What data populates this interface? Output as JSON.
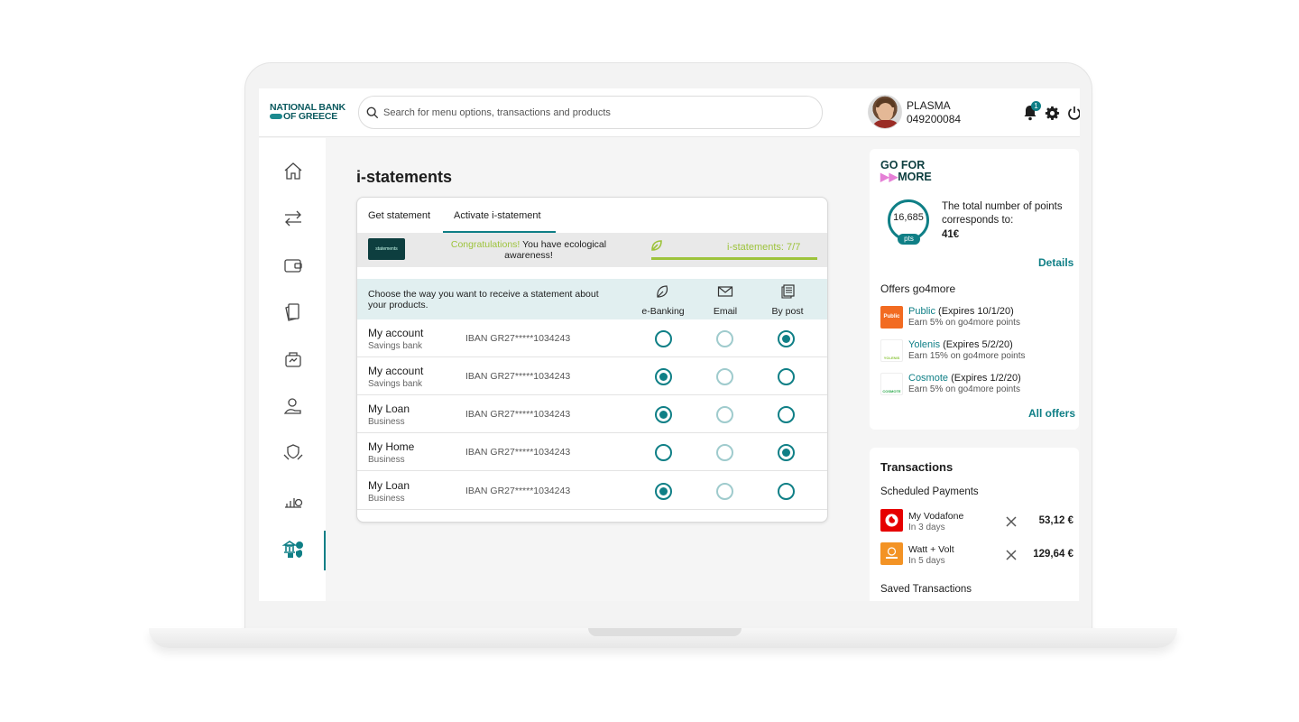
{
  "brand": {
    "line1": "NATIONAL BANK",
    "line2": "OF GREECE"
  },
  "search": {
    "placeholder": "Search for menu options, transactions and products"
  },
  "user": {
    "name": "PLASMA",
    "id": "049200084",
    "notifications": "1"
  },
  "page": {
    "title": "i-statements"
  },
  "tabs": [
    {
      "label": "Get statement",
      "active": false
    },
    {
      "label": "Activate i-statement",
      "active": true
    }
  ],
  "banner": {
    "logo_text": "statements",
    "highlight": "Congratulations!",
    "message": "You have ecological awareness!",
    "progress_label": "i-statements: 7/7",
    "progress_fraction": 1.0
  },
  "preferences": {
    "prompt": "Choose the way you want to receive a statement about your products.",
    "columns": [
      "e-Banking",
      "Email",
      "By post"
    ],
    "rows": [
      {
        "name": "My account",
        "type": "Savings bank",
        "iban": "IBAN GR27*****1034243",
        "selected": "By post"
      },
      {
        "name": "My account",
        "type": "Savings bank",
        "iban": "IBAN GR27*****1034243",
        "selected": "e-Banking"
      },
      {
        "name": "My Loan",
        "type": "Business",
        "iban": "IBAN GR27*****1034243",
        "selected": "e-Banking"
      },
      {
        "name": "My Home",
        "type": "Business",
        "iban": "IBAN GR27*****1034243",
        "selected": "By post"
      },
      {
        "name": "My Loan",
        "type": "Business",
        "iban": "IBAN GR27*****1034243",
        "selected": "e-Banking"
      }
    ]
  },
  "go4more": {
    "logo_line1": "GO FOR",
    "logo_line2": "MORE",
    "points": "16,685",
    "points_unit": "pts",
    "description": "The total number of points corresponds to:",
    "value": "41€",
    "details_link": "Details",
    "offers_title": "Offers go4more",
    "offers": [
      {
        "brand": "Public",
        "expires": "(Expires 10/1/20)",
        "desc": "Earn 5% on go4more points",
        "color": "#f26b21",
        "logo": "Public"
      },
      {
        "brand": "Yolenis",
        "expires": "(Expires 5/2/20)",
        "desc": "Earn 15% on go4more points",
        "color": "#8dc63f",
        "logo": "YOLENIS"
      },
      {
        "brand": "Cosmote",
        "expires": "(Expires 1/2/20)",
        "desc": "Earn 5% on go4more points",
        "color": "#2aa84a",
        "logo": "COSMOTE"
      }
    ],
    "all_offers_link": "All offers"
  },
  "transactions": {
    "title": "Transactions",
    "scheduled_title": "Scheduled Payments",
    "scheduled": [
      {
        "name": "My Vodafone",
        "when": "In 3 days",
        "amount": "53,12 €",
        "color": "#e60000"
      },
      {
        "name": "Watt + Volt",
        "when": "In 5 days",
        "amount": "129,64 €",
        "color": "#f39325"
      }
    ],
    "saved_title": "Saved Transactions"
  },
  "colors": {
    "accent": "#0f7f86",
    "eco": "#9dc33b",
    "brand_dark": "#0d3e3f"
  }
}
